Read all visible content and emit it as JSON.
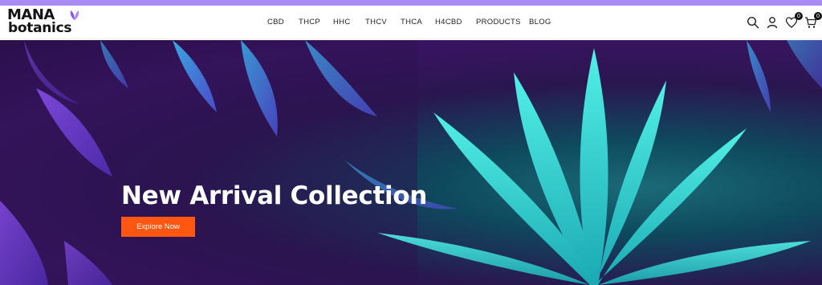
{
  "brand": {
    "line1": "MANA",
    "line2": "botanics",
    "accent": "#8a56f0"
  },
  "nav": {
    "items": [
      {
        "label": "CBD"
      },
      {
        "label": "THCP"
      },
      {
        "label": "HHC"
      },
      {
        "label": "THCV"
      },
      {
        "label": "THCA"
      },
      {
        "label": "H4CBD"
      },
      {
        "label": "PRODUCTS"
      },
      {
        "label": "BLOG"
      }
    ]
  },
  "header_icons": {
    "search": "search-icon",
    "account": "user-icon",
    "wishlist": {
      "icon": "heart-icon",
      "count": "0"
    },
    "cart": {
      "icon": "cart-icon",
      "count": "0"
    }
  },
  "hero": {
    "title": "New Arrival Collection",
    "button_label": "Explore Now",
    "button_color": "#ff5612"
  },
  "colors": {
    "top_stripe": "#a98bf6",
    "hero_teal": "#2fd9d0",
    "hero_purple": "#3a1463"
  }
}
